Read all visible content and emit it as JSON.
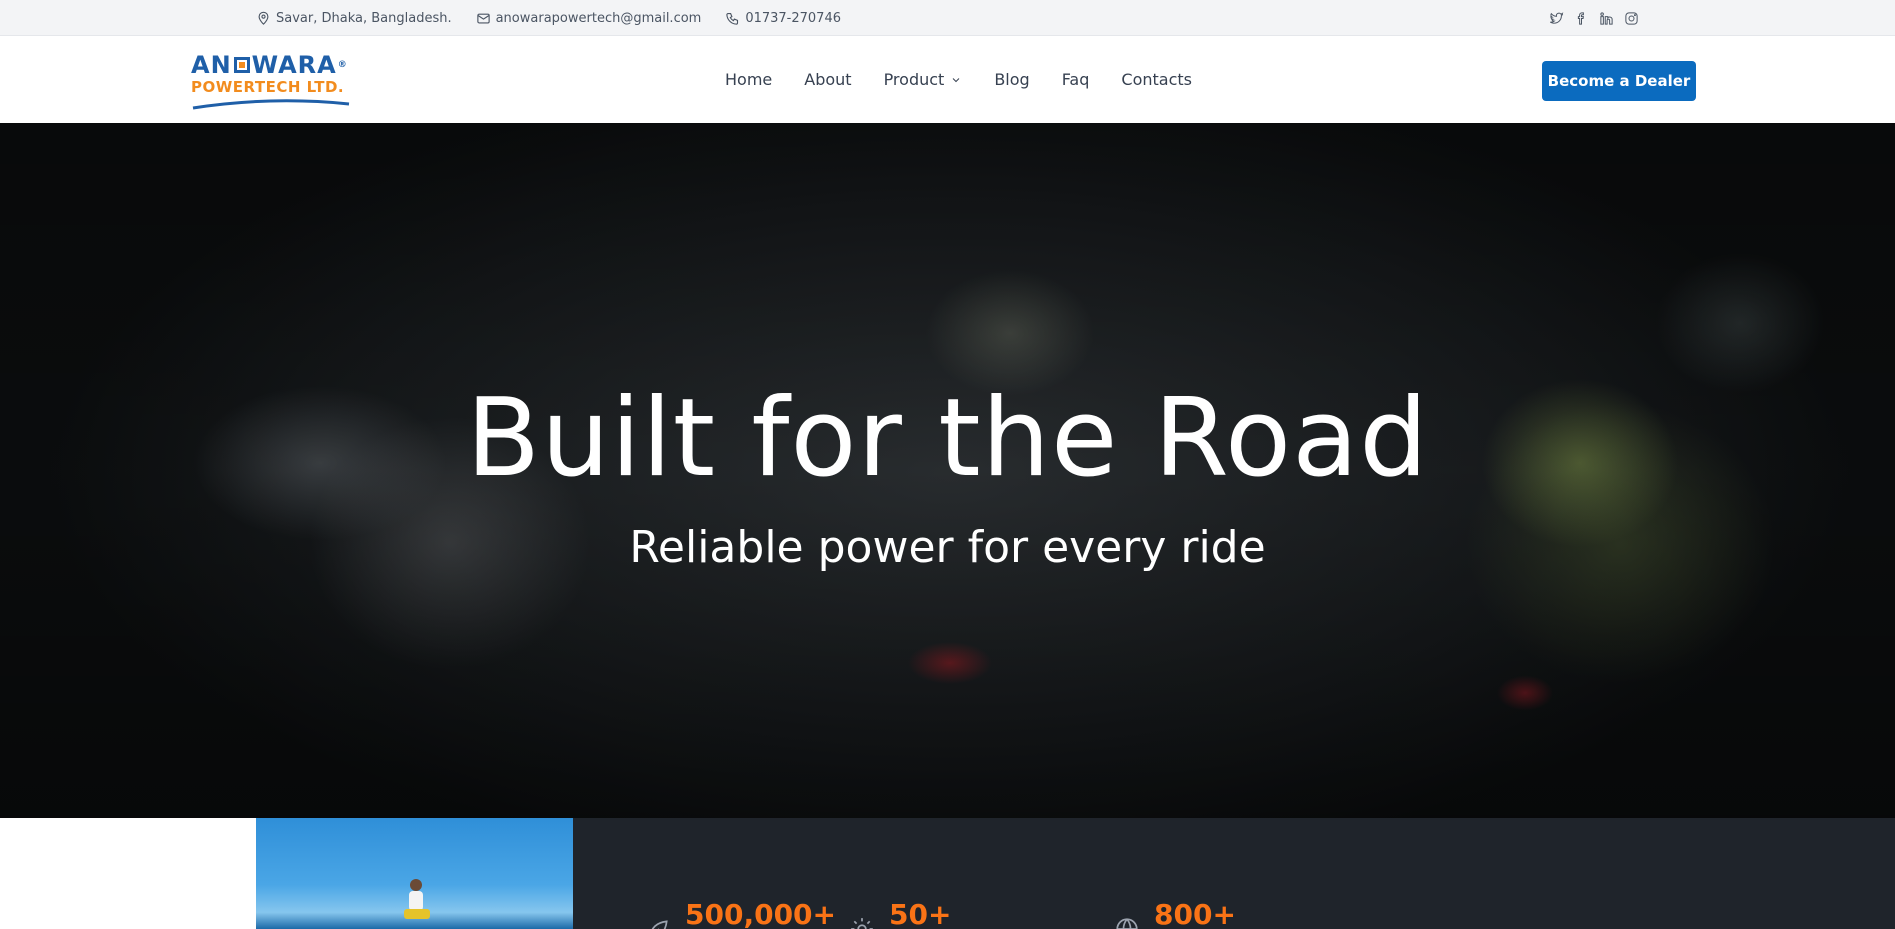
{
  "topbar": {
    "address": "Savar, Dhaka, Bangladesh.",
    "email": "anowarapowertech@gmail.com",
    "phone": "01737-270746",
    "social_icons": [
      "twitter-icon",
      "facebook-icon",
      "linkedin-icon",
      "instagram-icon"
    ]
  },
  "header": {
    "logo_top": "ANOWARA",
    "logo_bottom": "POWERTECH LTD.",
    "nav": {
      "home": "Home",
      "about": "About",
      "product": "Product",
      "blog": "Blog",
      "faq": "Faq",
      "contacts": "Contacts"
    },
    "cta": "Become a Dealer"
  },
  "hero": {
    "title": "Built for the Road",
    "subtitle": "Reliable power for every ride"
  },
  "stats": [
    {
      "value": "500,000+",
      "icon": "leaf-icon"
    },
    {
      "value": "50+",
      "icon": "gear-icon"
    },
    {
      "value": "800+",
      "icon": "globe-icon"
    }
  ],
  "colors": {
    "brand_blue": "#0b6bbf",
    "accent_orange": "#f97316",
    "stats_bg": "#1f242b",
    "topbar_bg": "#f3f4f6"
  }
}
